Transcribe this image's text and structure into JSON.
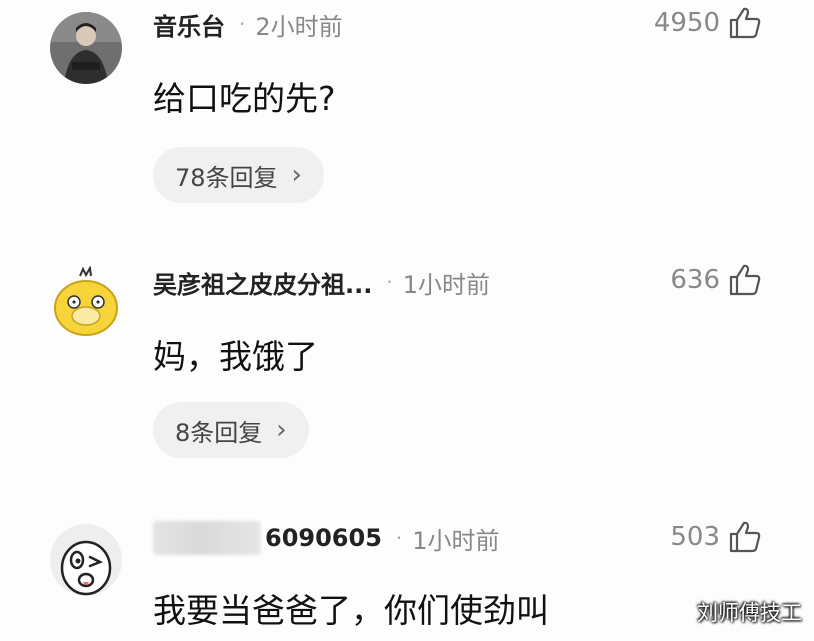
{
  "comments": [
    {
      "user": "音乐台",
      "separator": "·",
      "time": "2小时前",
      "likes": "4950",
      "text": "给口吃的先?",
      "replies_label": "78条回复",
      "chevron": "›",
      "avatar_icon": "man-portrait-avatar"
    },
    {
      "user": "吴彦祖之皮皮分祖...",
      "separator": "·",
      "time": "1小时前",
      "likes": "636",
      "text": "妈，我饿了",
      "replies_label": "8条回复",
      "chevron": "›",
      "avatar_icon": "yellow-duck-avatar"
    },
    {
      "user": "6090605",
      "separator": "·",
      "time": "1小时前",
      "likes": "503",
      "text": "我要当爸爸了，你们使劲叫",
      "avatar_icon": "cartoon-face-avatar"
    }
  ],
  "watermark": "刘师傅技工",
  "icons": {
    "like": "thumbs-up-icon"
  },
  "colors": {
    "background": "#fdfdfd",
    "reply_pill": "#f0f0f0",
    "muted": "#888888"
  }
}
